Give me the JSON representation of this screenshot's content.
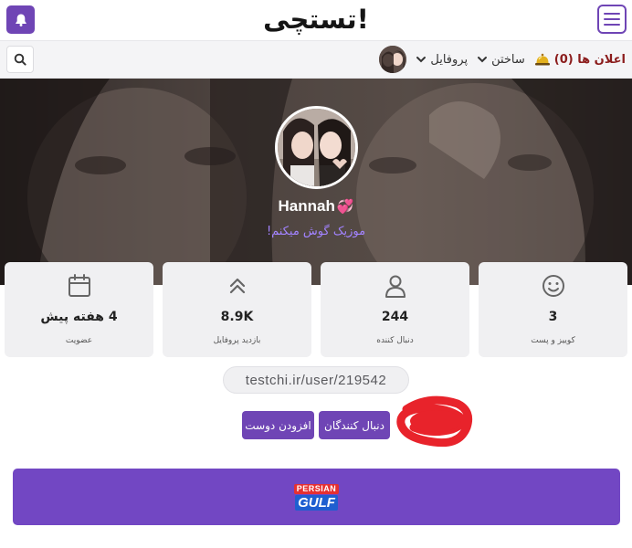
{
  "header": {
    "logo_text": "تستچی!",
    "bell_icon": "bell-icon",
    "menu_icon": "hamburger-icon"
  },
  "nav": {
    "search_icon": "search-icon",
    "items": [
      {
        "label": "پروفایل",
        "icon": "chevron-down-icon"
      },
      {
        "label": "ساختن",
        "icon": "chevron-down-icon"
      },
      {
        "label": "اعلان ها (0)",
        "icon": "service-bell-icon"
      }
    ],
    "announce_color": "#8b1c1c"
  },
  "profile": {
    "name": "Hannah",
    "name_emoji": "💞",
    "bio": "موزیک گوش میکنم!",
    "profile_url": "testchi.ir/user/219542"
  },
  "stats": [
    {
      "icon": "smile-icon",
      "value": "3",
      "label": "کوییز و پست"
    },
    {
      "icon": "user-icon",
      "value": "244",
      "label": "دنبال کننده"
    },
    {
      "icon": "double-chevron-up-icon",
      "value": "8.9K",
      "label": "بازدید پروفایل"
    },
    {
      "icon": "calendar-icon",
      "value": "4 هفته پیش",
      "label": "عضویت"
    }
  ],
  "buttons": {
    "followers": "دنبال کنندگان",
    "add_friend": "افزودن دوست"
  },
  "banner": {
    "line1": "PERSIAN",
    "line2": "GULF"
  },
  "colors": {
    "accent": "#6f45b5",
    "banner_bg": "#7247c3",
    "scribble": "#e8232b",
    "bio": "#a283ff"
  }
}
